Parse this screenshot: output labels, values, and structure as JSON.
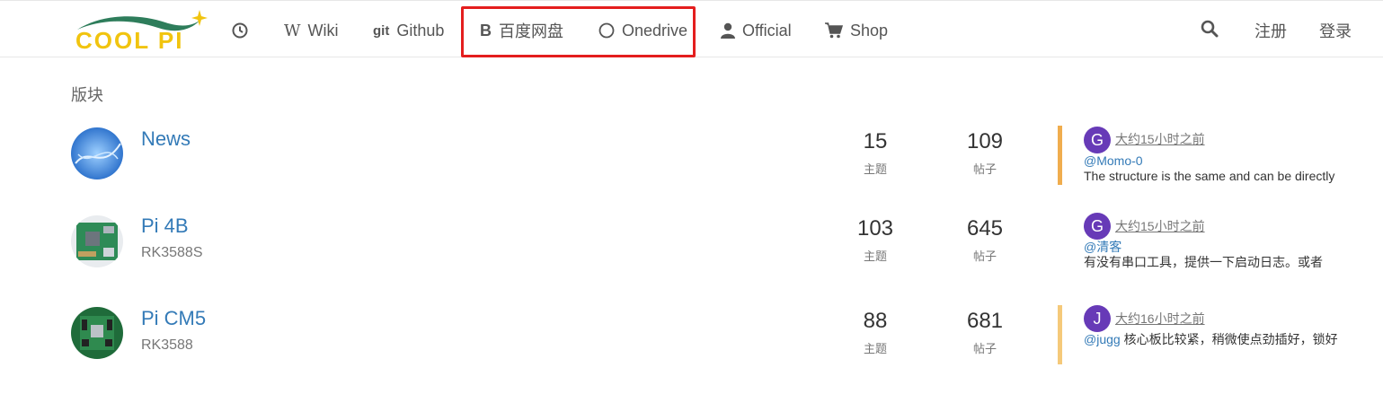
{
  "brand": {
    "logo_text": "COOL PI"
  },
  "nav": {
    "items": [
      {
        "id": "recent",
        "icon": "clock-icon",
        "label": ""
      },
      {
        "id": "wiki",
        "icon": "wikipedia-w-icon",
        "icon_text": "W",
        "label": "Wiki"
      },
      {
        "id": "github",
        "icon": "git-icon",
        "icon_text": "git",
        "label": "Github"
      },
      {
        "id": "baidu",
        "icon": "bold-b-icon",
        "icon_text": "B",
        "label": "百度网盘"
      },
      {
        "id": "onedrive",
        "icon": "circle-outline-icon",
        "label": "Onedrive"
      },
      {
        "id": "official",
        "icon": "user-icon",
        "label": "Official"
      },
      {
        "id": "shop",
        "icon": "cart-icon",
        "label": "Shop"
      }
    ],
    "right": {
      "search_icon": "search-icon",
      "register": "注册",
      "login": "登录"
    }
  },
  "section_title": "版块",
  "categories": [
    {
      "title": "News",
      "description": "",
      "topics": "15",
      "topics_label": "主题",
      "posts": "109",
      "posts_label": "帖子",
      "bar_color": "#f0ad4e",
      "teaser": {
        "avatar_letter": "G",
        "time": "大约15小时之前",
        "user": "@Momo-0",
        "text": "The structure is the same and can be directly"
      }
    },
    {
      "title": "Pi 4B",
      "description": "RK3588S",
      "topics": "103",
      "topics_label": "主题",
      "posts": "645",
      "posts_label": "帖子",
      "bar_color": "",
      "teaser": {
        "avatar_letter": "G",
        "time": "大约15小时之前",
        "user": "@清客",
        "text": "有没有串口工具，提供一下启动日志。或者"
      }
    },
    {
      "title": "Pi CM5",
      "description": "RK3588",
      "topics": "88",
      "topics_label": "主题",
      "posts": "681",
      "posts_label": "帖子",
      "bar_color": "#f5c97a",
      "teaser": {
        "avatar_letter": "J",
        "time": "大约16小时之前",
        "user": "@jugg",
        "text": " 核心板比较紧，稍微使点劲插好，锁好"
      }
    }
  ],
  "colors": {
    "accent": "#337ab7",
    "highlight": "#e41e1e",
    "avatar_bg": "#673ab7"
  }
}
